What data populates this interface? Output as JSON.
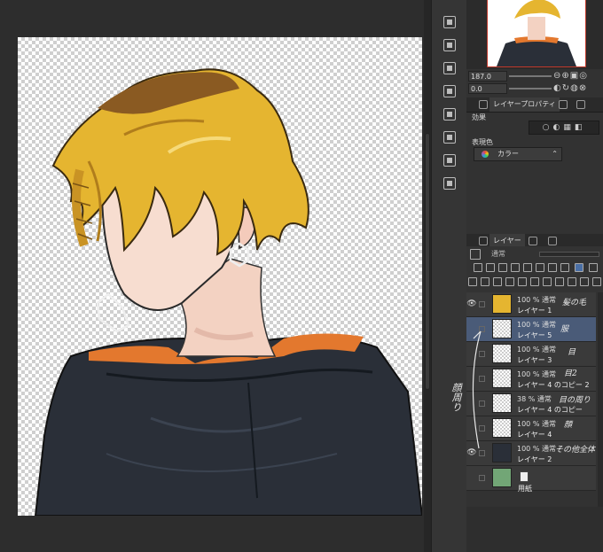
{
  "navigator": {
    "zoom_value": "187.0",
    "rotate_value": "0.0",
    "zoom_icons": "⊖⊕▣◎",
    "rotate_icons": "◐↻◍⊗"
  },
  "property_panel": {
    "tabs": [
      "レイヤープロパティ"
    ],
    "effect_label": "効果",
    "expression_label": "表現色",
    "expression_value": "カラー",
    "effect_icons": "○◐▦◧"
  },
  "layer_panel": {
    "tab_label": "レイヤー",
    "blend_mode": "通常",
    "layers": [
      {
        "mode": "100 % 通常",
        "name": "レイヤー 1",
        "visible": true,
        "selected": false,
        "note": "髪の毛"
      },
      {
        "mode": "100 % 通常",
        "name": "レイヤー 5",
        "visible": false,
        "selected": true,
        "note": "服"
      },
      {
        "mode": "100 % 通常",
        "name": "レイヤー 3",
        "visible": false,
        "selected": false,
        "note": "目"
      },
      {
        "mode": "100 % 通常",
        "name": "レイヤー 4 のコピー 2",
        "visible": false,
        "selected": false,
        "note": "目2"
      },
      {
        "mode": "38 % 通常",
        "name": "レイヤー 4 のコピー",
        "visible": false,
        "selected": false,
        "note": "目の周り"
      },
      {
        "mode": "100 % 通常",
        "name": "レイヤー 4",
        "visible": false,
        "selected": false,
        "note": "顔"
      },
      {
        "mode": "100 % 通常",
        "name": "レイヤー 2",
        "visible": true,
        "selected": false,
        "note": "その他全体"
      },
      {
        "mode": "",
        "name": "用紙",
        "visible": false,
        "selected": false,
        "note": ""
      }
    ],
    "side_note": "顔周り"
  },
  "colors": {
    "panel_bg": "#323232",
    "selected_layer": "#4a5b78",
    "paper_color": "#72a676",
    "hair": "#e5b530",
    "hoodie": "#2a2f38",
    "hoodie_lining": "#e3782e"
  }
}
